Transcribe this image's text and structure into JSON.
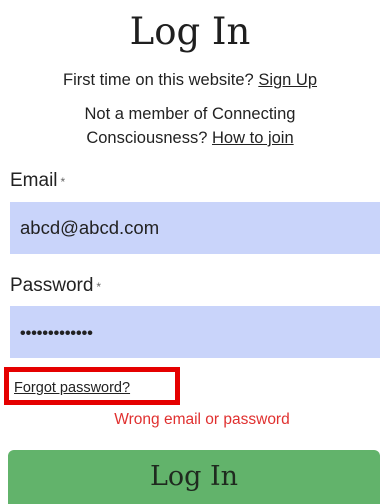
{
  "header": {
    "title": "Log In"
  },
  "signup": {
    "prompt": "First time on this website?",
    "link": "Sign Up"
  },
  "join": {
    "prompt": "Not a member of Connecting Consciousness?",
    "link": "How to join"
  },
  "form": {
    "email_label": "Email",
    "email_value": "abcd@abcd.com",
    "password_label": "Password",
    "password_value": "•••••••••••••",
    "required_marker": "*",
    "forgot_link": "Forgot password?",
    "error_message": "Wrong email or password",
    "submit_label": "Log In"
  },
  "colors": {
    "input_background": "#c9d4fa",
    "submit_background": "#62b36b",
    "error_text": "#e0302f",
    "highlight_border": "#e50000"
  }
}
